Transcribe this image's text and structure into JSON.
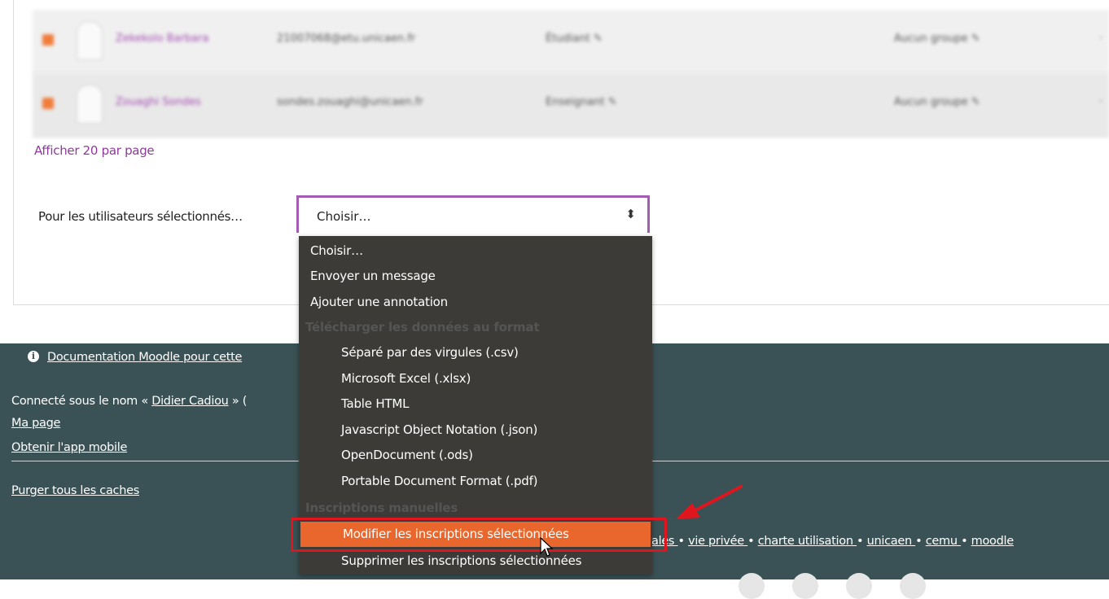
{
  "participants": {
    "rows": [
      {
        "name": "Zekekolo Barbara",
        "email": "21007068@etu.unicaen.fr",
        "role": "Étudiant",
        "group": "Aucun groupe"
      },
      {
        "name": "Zouaghi Sondes",
        "email": "sondes.zouaghi@unicaen.fr",
        "role": "Enseignant",
        "group": "Aucun groupe"
      }
    ],
    "per_page_link": "Afficher 20 par page"
  },
  "bulk_action": {
    "label": "Pour les utilisateurs sélectionnés…",
    "selected": "Choisir…",
    "options": {
      "choose": "Choisir…",
      "send_message": "Envoyer un message",
      "add_note": "Ajouter une annotation",
      "download_group": "Télécharger les données au format",
      "csv": "Séparé par des virgules (.csv)",
      "xlsx": "Microsoft Excel (.xlsx)",
      "html": "Table HTML",
      "json": "Javascript Object Notation (.json)",
      "ods": "OpenDocument (.ods)",
      "pdf": "Portable Document Format (.pdf)",
      "manual_group": "Inscriptions manuelles",
      "edit_enrol": "Modifier les inscriptions sélectionnées",
      "delete_enrol": "Supprimer les inscriptions sélectionnées"
    }
  },
  "footer": {
    "doc_link": "Documentation Moodle pour cette",
    "logged_prefix": "Connecté sous le nom « ",
    "user_name": "Didier Cadiou",
    "logged_suffix": " » (",
    "my_page": "Ma page",
    "mobile_app": "Obtenir l'app mobile",
    "purge_caches": "Purger tous les caches",
    "links": {
      "legal_tail": "ales ",
      "privacy": "vie privée ",
      "charter": "charte utilisation ",
      "unicaen": "unicaen ",
      "cemu": "cemu ",
      "moodle": "moodle",
      "sep": " • "
    }
  },
  "colors": {
    "accent_purple": "#a35bb4",
    "footer_bg": "#3a5256",
    "dropdown_bg": "#3c3b37",
    "highlight_orange": "#e9672d",
    "annotation_red": "#e0161e"
  }
}
